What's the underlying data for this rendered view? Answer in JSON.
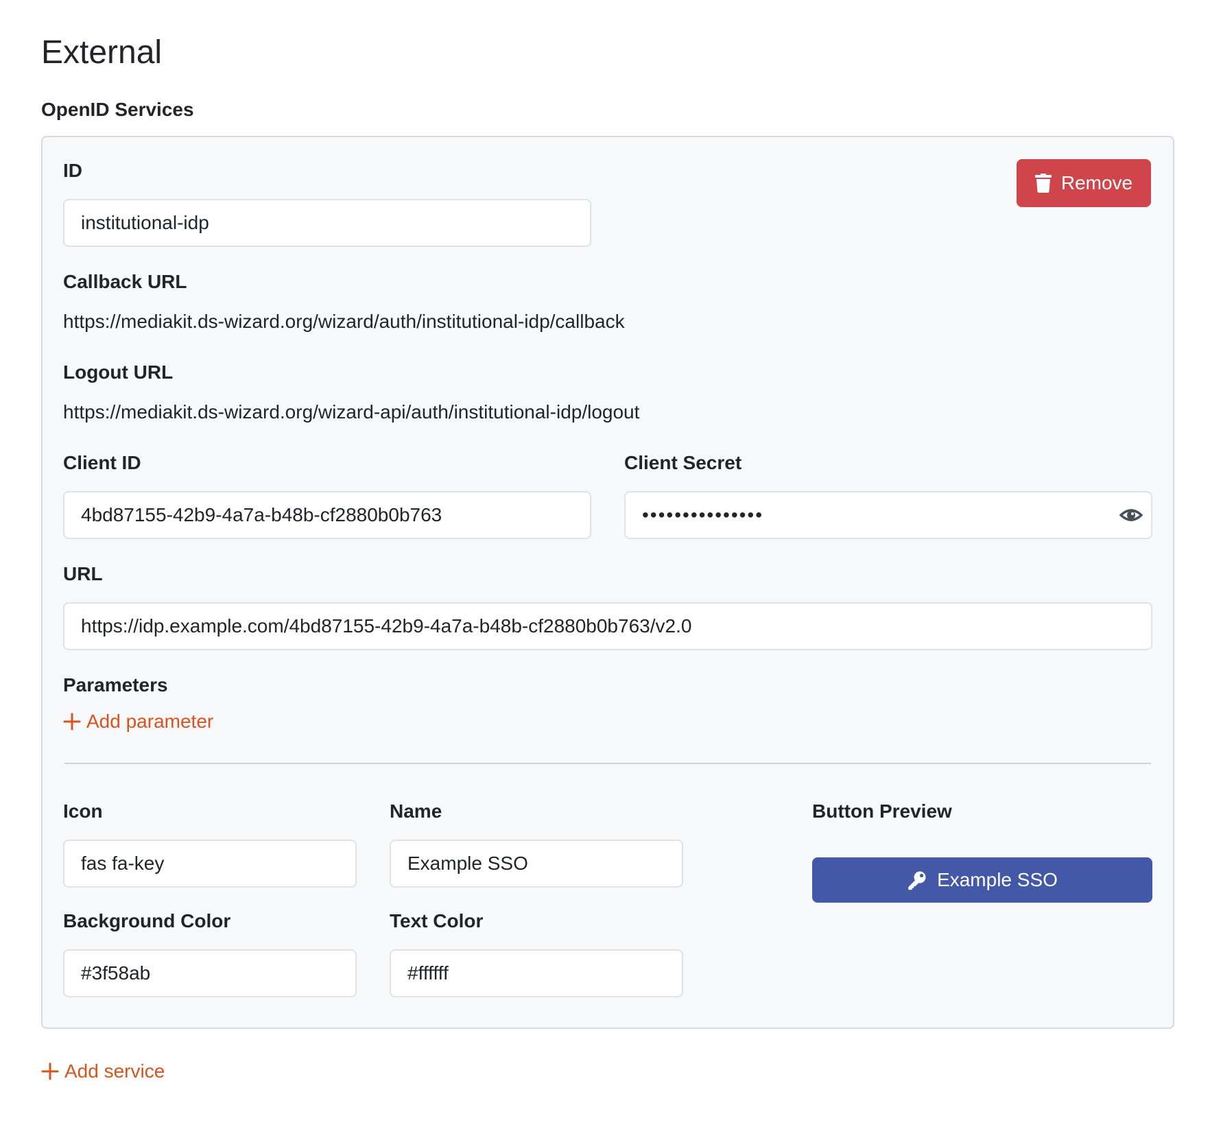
{
  "page": {
    "title": "External"
  },
  "openid": {
    "section_title": "OpenID Services",
    "service": {
      "remove_label": "Remove",
      "id": {
        "label": "ID",
        "value": "institutional-idp"
      },
      "callback_url": {
        "label": "Callback URL",
        "value": "https://mediakit.ds-wizard.org/wizard/auth/institutional-idp/callback"
      },
      "logout_url": {
        "label": "Logout URL",
        "value": "https://mediakit.ds-wizard.org/wizard-api/auth/institutional-idp/logout"
      },
      "client_id": {
        "label": "Client ID",
        "value": "4bd87155-42b9-4a7a-b48b-cf2880b0b763"
      },
      "client_secret": {
        "label": "Client Secret",
        "value": "•••••••••••••••"
      },
      "url": {
        "label": "URL",
        "value": "https://idp.example.com/4bd87155-42b9-4a7a-b48b-cf2880b0b763/v2.0"
      },
      "parameters": {
        "label": "Parameters",
        "add_label": "Add parameter"
      },
      "icon": {
        "label": "Icon",
        "value": "fas fa-key"
      },
      "name": {
        "label": "Name",
        "value": "Example SSO"
      },
      "background_color": {
        "label": "Background Color",
        "value": "#3f58ab"
      },
      "text_color": {
        "label": "Text Color",
        "value": "#ffffff"
      },
      "button_preview": {
        "label": "Button Preview",
        "text": "Example SSO",
        "icon": "key-icon"
      }
    },
    "add_service_label": "Add service"
  },
  "colors": {
    "danger": "#d0454c",
    "accent_link": "#d9531e",
    "preview_background": "#4458a8",
    "preview_text": "#ffffff",
    "card_background": "#f7f8fa"
  }
}
